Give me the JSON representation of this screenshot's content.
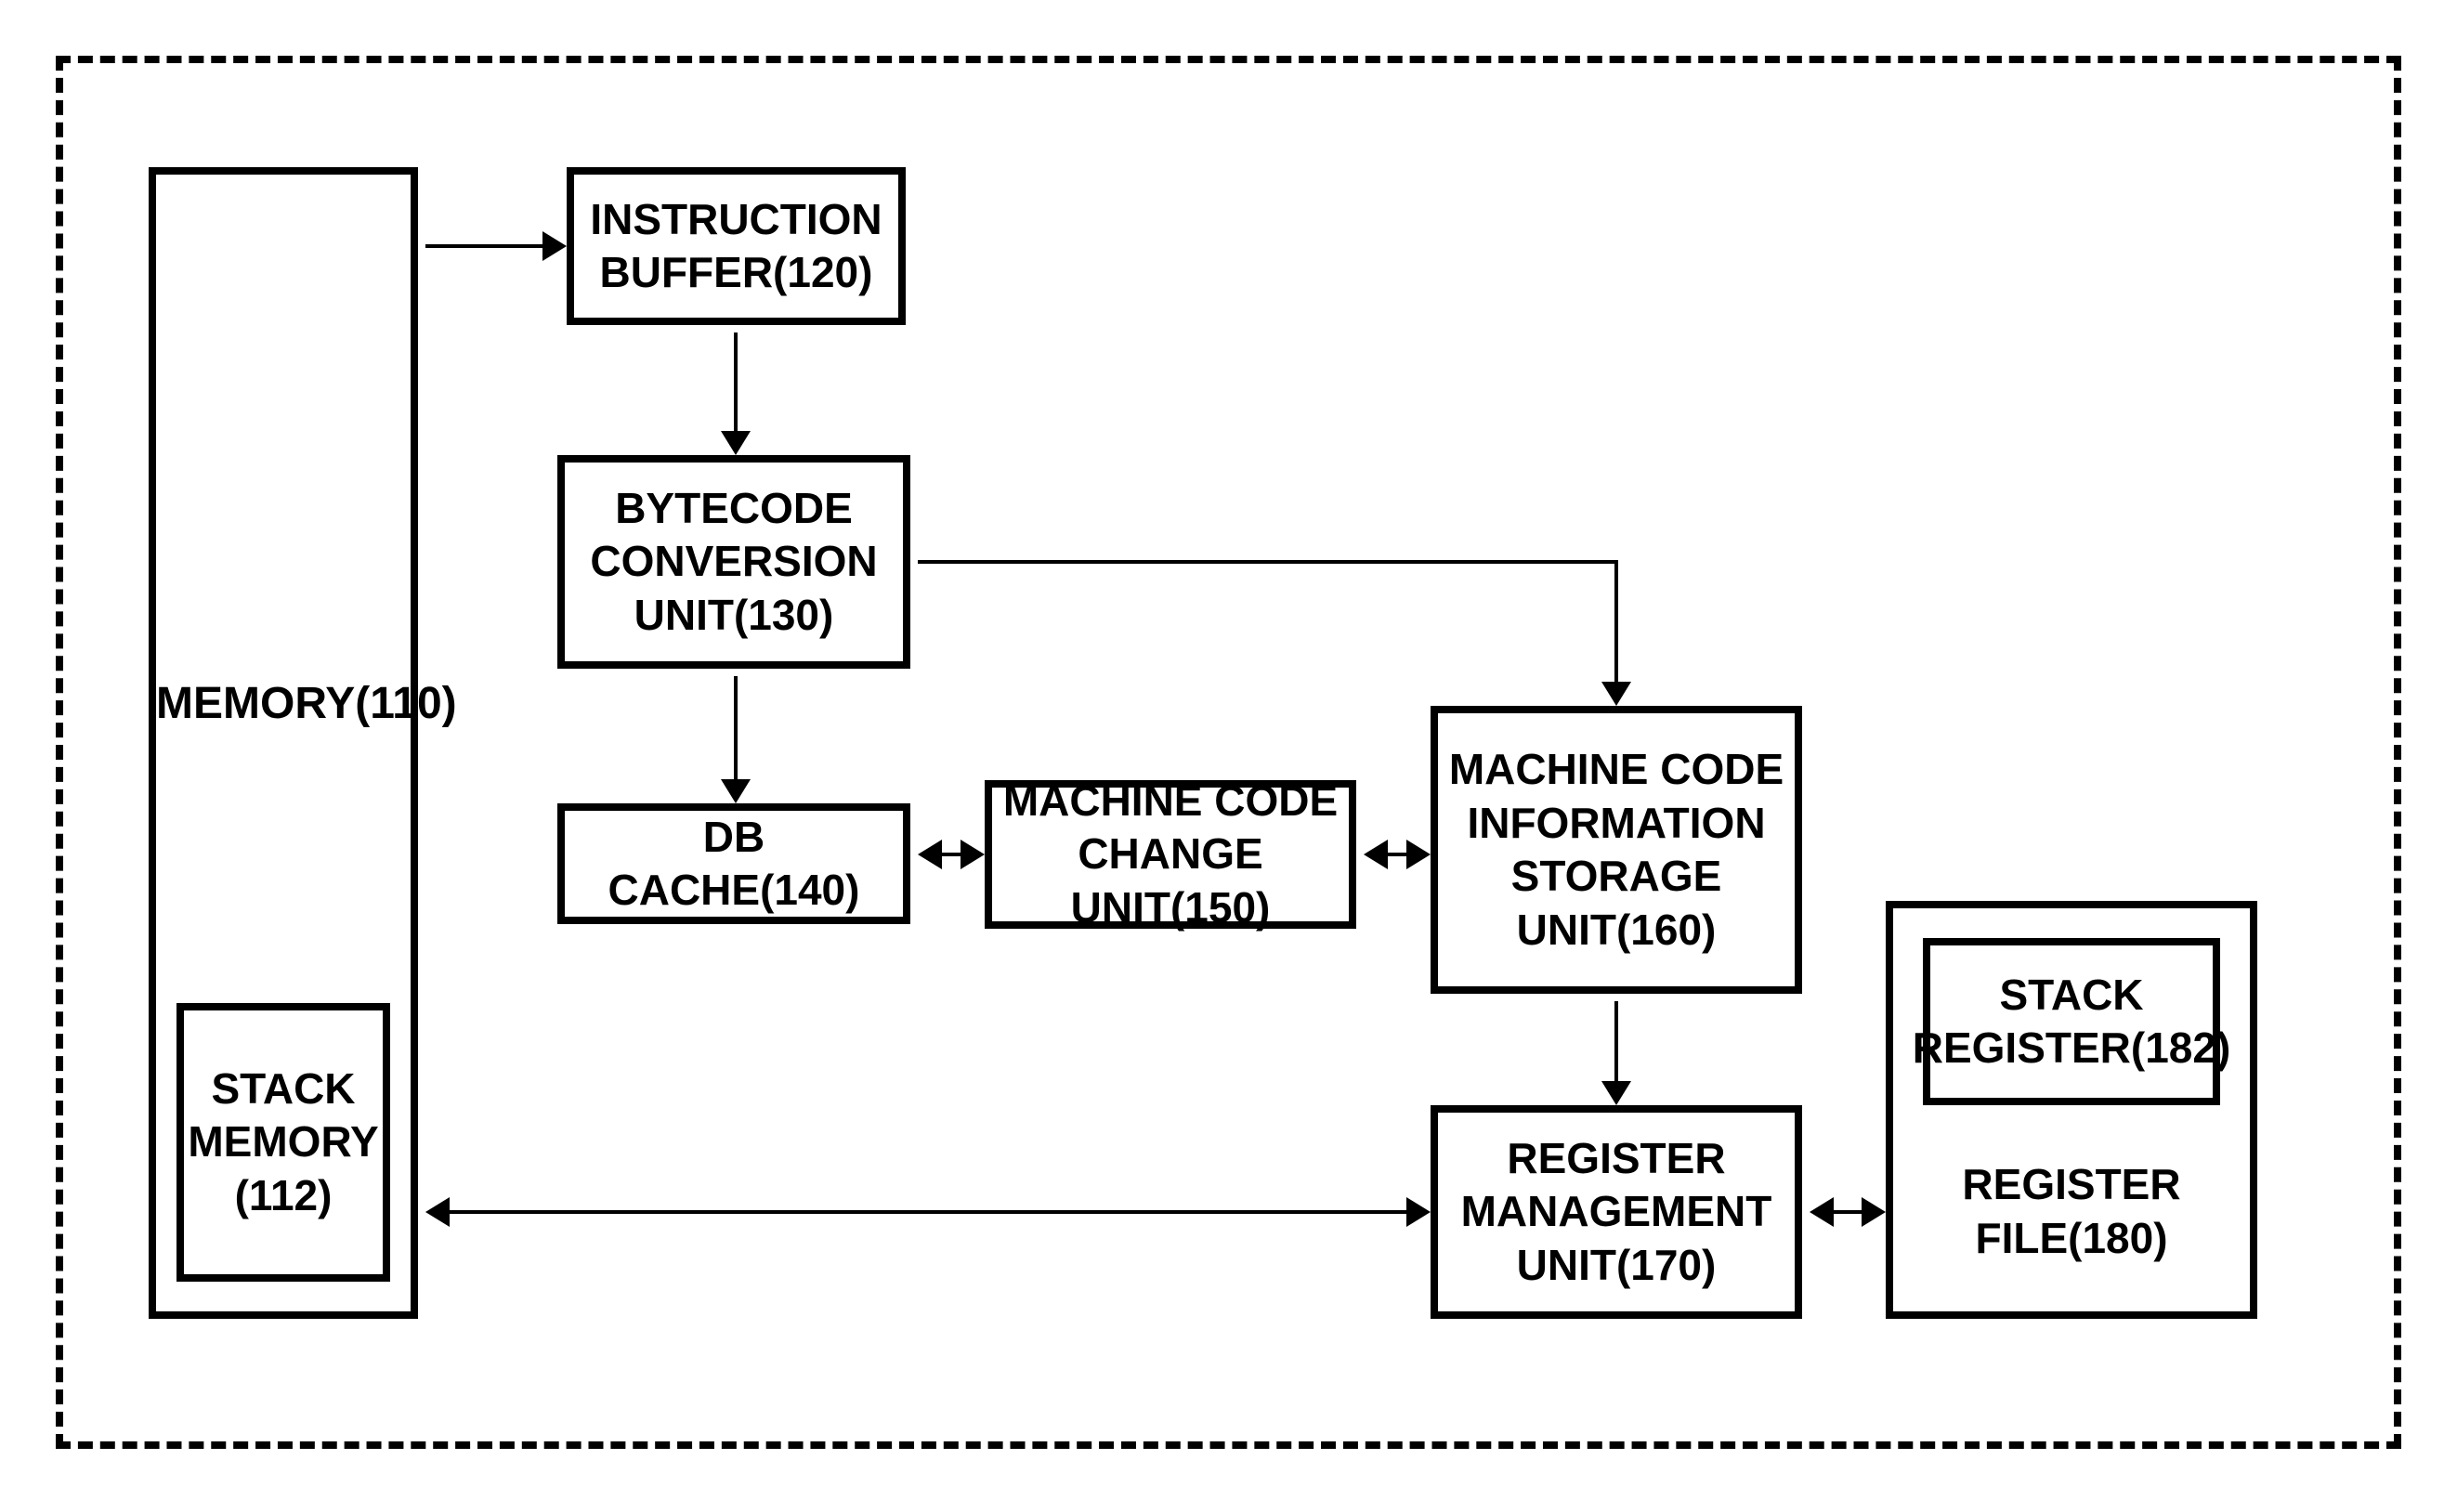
{
  "boxes": {
    "memory": "MEMORY(110)",
    "stack_memory": "STACK\nMEMORY\n(112)",
    "instruction_buffer": "INSTRUCTION\nBUFFER(120)",
    "bytecode_conversion": "BYTECODE\nCONVERSION\nUNIT(130)",
    "db_cache": "DB CACHE(140)",
    "machine_code_change": "MACHINE CODE\nCHANGE UNIT(150)",
    "machine_code_info_storage": "MACHINE CODE\nINFORMATION\nSTORAGE\nUNIT(160)",
    "register_management": "REGISTER\nMANAGEMENT\nUNIT(170)",
    "register_file": "REGISTER\nFILE(180)",
    "stack_register": "STACK\nREGISTER(182)"
  }
}
